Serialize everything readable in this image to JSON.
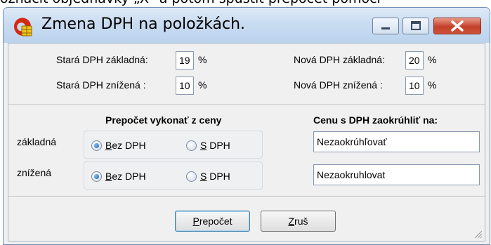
{
  "background_text": "označit objednávky „X\" a potom spustit přepočet pomocí",
  "window": {
    "title": "Zmena DPH na položkách.",
    "controls": {
      "minimize": "minimize-icon",
      "maximize": "maximize-icon",
      "close": "close-icon"
    }
  },
  "rates": {
    "old_basic_label": "Stará DPH základná:",
    "old_basic_value": "19",
    "old_reduced_label": "Stará DPH znížená :",
    "old_reduced_value": "10",
    "new_basic_label": "Nová DPH základná:",
    "new_basic_value": "20",
    "new_reduced_label": "Nová DPH znížená :",
    "new_reduced_value": "10",
    "percent": "%"
  },
  "recalc": {
    "heading": "Prepočet vykonať z ceny",
    "rows": [
      {
        "label": "základná",
        "opt1_prefix": "B",
        "opt1_rest": "ez DPH",
        "opt2_prefix": "S",
        "opt2_rest": " DPH",
        "selected": "bez"
      },
      {
        "label": "znížená",
        "opt1_prefix": "B",
        "opt1_rest": "ez DPH",
        "opt2_prefix": "S",
        "opt2_rest": " DPH",
        "selected": "bez"
      }
    ]
  },
  "rounding": {
    "heading": "Cenu s DPH  zaokrúhliť na:",
    "basic_value": "Nezaokrúhľovať",
    "reduced_value": "Nezaokruhlovat"
  },
  "buttons": {
    "recalc_prefix": "P",
    "recalc_rest": "repočet",
    "cancel_prefix": "Z",
    "cancel_rest": "ruš"
  },
  "colors": {
    "titlebar": "#c9dcf1",
    "close": "#c4402a",
    "radio_selected": "#1b5aa7"
  }
}
